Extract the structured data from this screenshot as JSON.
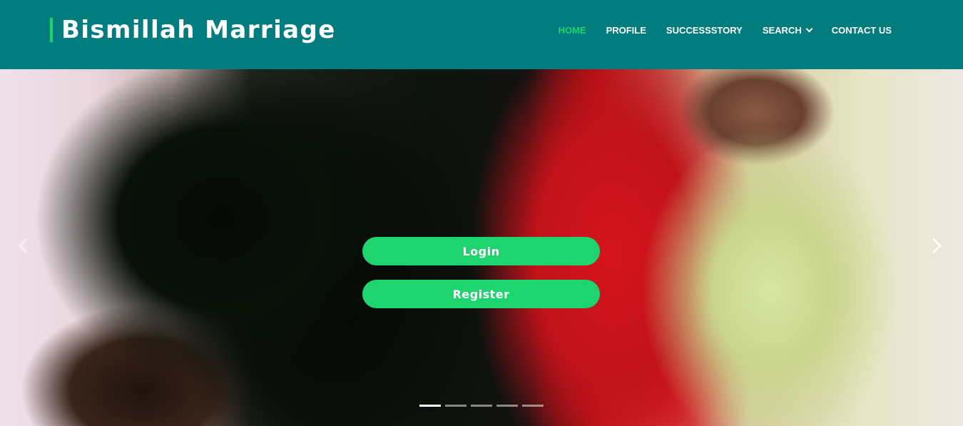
{
  "brand": {
    "title": "Bismillah Marriage",
    "accent_color": "#1ed46f",
    "header_color": "#027c7d"
  },
  "nav": {
    "items": [
      {
        "label": "HOME",
        "active": true
      },
      {
        "label": "PROFILE",
        "active": false
      },
      {
        "label": "SUCCESSSTORY",
        "active": false
      },
      {
        "label": "SEARCH",
        "active": false,
        "has_dropdown": true,
        "icon": "chevron-down-icon"
      },
      {
        "label": "CONTACT US",
        "active": false
      }
    ]
  },
  "hero": {
    "slide_count": 5,
    "active_slide": 1,
    "prev_icon": "chevron-left-icon",
    "next_icon": "chevron-right-icon",
    "buttons": {
      "login_label": "Login",
      "register_label": "Register"
    }
  }
}
